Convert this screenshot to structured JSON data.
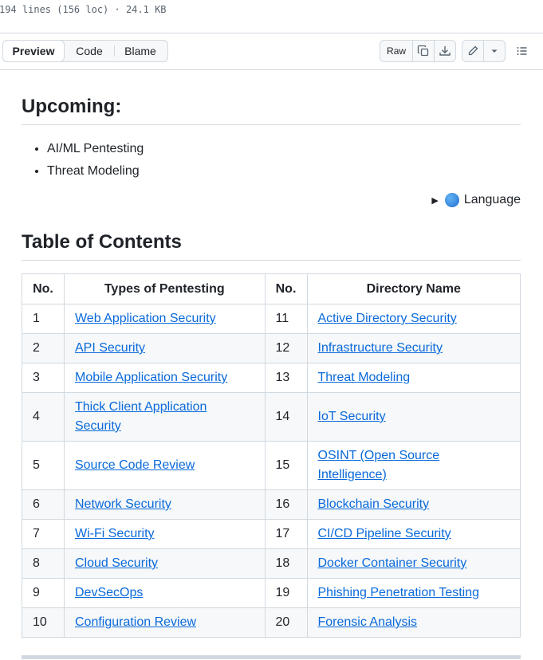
{
  "file_info": "194 lines (156 loc) · 24.1 KB",
  "toolbar": {
    "tabs": [
      "Preview",
      "Code",
      "Blame"
    ],
    "raw_label": "Raw",
    "icons": [
      "copy-icon",
      "download-icon",
      "pencil-icon",
      "triangle-down-icon",
      "list-unordered-icon"
    ]
  },
  "upcoming": {
    "heading": "Upcoming:",
    "items": [
      "AI/ML Pentesting",
      "Threat Modeling"
    ]
  },
  "language": {
    "label": "Language",
    "icon": "globe-icon"
  },
  "toc": {
    "heading": "Table of Contents",
    "headers": [
      "No.",
      "Types of Pentesting",
      "No.",
      "Directory Name"
    ],
    "rows": [
      {
        "n1": "1",
        "t1": "Web Application Security",
        "n2": "11",
        "t2": "Active Directory Security"
      },
      {
        "n1": "2",
        "t1": "API Security",
        "n2": "12",
        "t2": "Infrastructure Security"
      },
      {
        "n1": "3",
        "t1": "Mobile Application Security",
        "n2": "13",
        "t2": "Threat Modeling"
      },
      {
        "n1": "4",
        "t1": "Thick Client Application Security",
        "n2": "14",
        "t2": "IoT Security"
      },
      {
        "n1": "5",
        "t1": "Source Code Review",
        "n2": "15",
        "t2": "OSINT (Open Source Intelligence)"
      },
      {
        "n1": "6",
        "t1": "Network Security",
        "n2": "16",
        "t2": "Blockchain Security"
      },
      {
        "n1": "7",
        "t1": "Wi-Fi Security",
        "n2": "17",
        "t2": "CI/CD Pipeline Security"
      },
      {
        "n1": "8",
        "t1": "Cloud Security",
        "n2": "18",
        "t2": "Docker Container Security"
      },
      {
        "n1": "9",
        "t1": "DevSecOps",
        "n2": "19",
        "t2": "Phishing Penetration Testing"
      },
      {
        "n1": "10",
        "t1": "Configuration Review",
        "n2": "20",
        "t2": "Forensic Analysis"
      }
    ]
  }
}
